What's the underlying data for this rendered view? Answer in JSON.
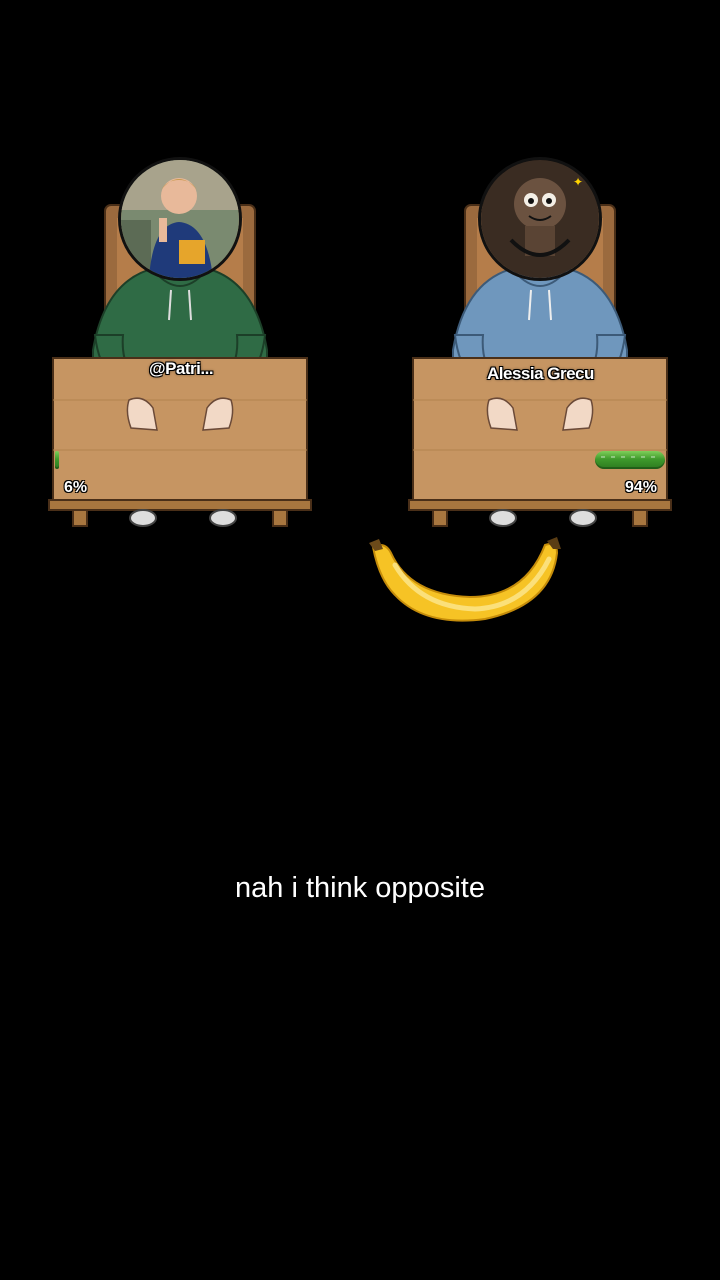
{
  "players": [
    {
      "name": "@Patri...",
      "percent": "6%",
      "percent_value": 0.06,
      "avatar": "boy-photo-avatar",
      "hoodie_color": "#2f6b45"
    },
    {
      "name": "Alessia Grecu",
      "percent": "94%",
      "percent_value": 0.94,
      "avatar": "cartoon-avatar",
      "hoodie_color": "#6f97bd"
    }
  ],
  "fruit": "banana-icon",
  "caption": "nah i think opposite",
  "colors": {
    "background": "#000000",
    "table": "#c69562",
    "bar": "#4caf50",
    "banana": "#f6c325"
  }
}
